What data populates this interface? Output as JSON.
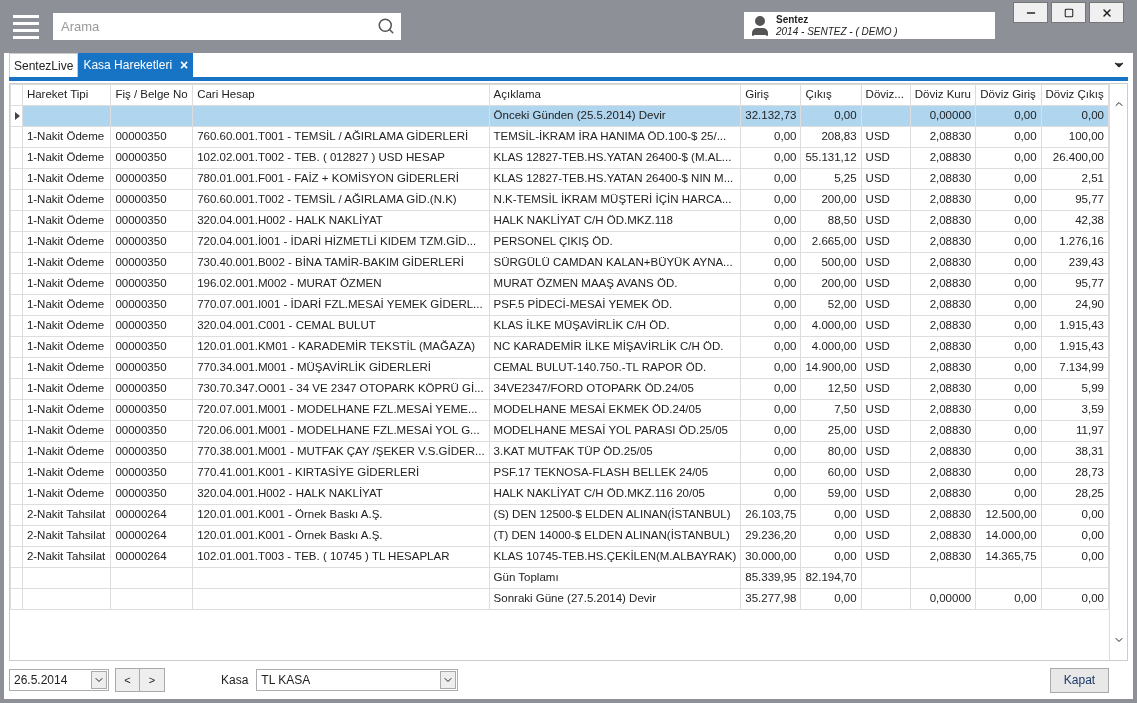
{
  "search": {
    "placeholder": "Arama"
  },
  "user": {
    "name": "Sentez",
    "company": "2014 - SENTEZ - ( DEMO )"
  },
  "tabs": [
    {
      "label": "SentezLive",
      "selected": false,
      "closable": false
    },
    {
      "label": "Kasa Hareketleri",
      "selected": true,
      "closable": true
    }
  ],
  "close_glyph": "×",
  "table": {
    "columns": [
      {
        "label": "Hareket Tipi",
        "kind": "text"
      },
      {
        "label": "Fiş / Belge No",
        "kind": "text"
      },
      {
        "label": "Cari Hesap",
        "kind": "text"
      },
      {
        "label": "Açıklama",
        "kind": "text"
      },
      {
        "label": "Giriş",
        "kind": "amount"
      },
      {
        "label": "Çıkış",
        "kind": "amount"
      },
      {
        "label": "Döviz...",
        "kind": "text"
      },
      {
        "label": "Döviz Kuru",
        "kind": "amount"
      },
      {
        "label": "Döviz Giriş",
        "kind": "amount"
      },
      {
        "label": "Döviz Çıkış",
        "kind": "amount"
      }
    ],
    "rows": [
      {
        "selected": true,
        "cells": [
          null,
          null,
          null,
          "Önceki Günden (25.5.2014) Devir",
          "32.132,73",
          "0,00",
          null,
          "0,00000",
          "0,00",
          "0,00"
        ]
      },
      {
        "selected": false,
        "cells": [
          "1-Nakit Ödeme",
          "00000350",
          "760.60.001.T001 - TEMSİL / AĞIRLAMA GİDERLERİ",
          "TEMSİL-İKRAM İRA HANIMA ÖD.100-$ 25/...",
          "0,00",
          "208,83",
          "USD",
          "2,08830",
          "0,00",
          "100,00"
        ]
      },
      {
        "selected": false,
        "cells": [
          "1-Nakit Ödeme",
          "00000350",
          "102.02.001.T002 - TEB. ( 012827 ) USD HESAP",
          "KLAS 12827-TEB.HS.YATAN 26400-$ (M.AL...",
          "0,00",
          "55.131,12",
          "USD",
          "2,08830",
          "0,00",
          "26.400,00"
        ]
      },
      {
        "selected": false,
        "cells": [
          "1-Nakit Ödeme",
          "00000350",
          "780.01.001.F001 - FAİZ + KOMİSYON GİDERLERİ",
          "KLAS 12827-TEB.HS.YATAN 26400-$ NIN M...",
          "0,00",
          "5,25",
          "USD",
          "2,08830",
          "0,00",
          "2,51"
        ]
      },
      {
        "selected": false,
        "cells": [
          "1-Nakit Ödeme",
          "00000350",
          "760.60.001.T002 - TEMSİL / AĞIRLAMA GİD.(N.K)",
          "N.K-TEMSİL İKRAM MÜŞTERİ İÇİN HARCA...",
          "0,00",
          "200,00",
          "USD",
          "2,08830",
          "0,00",
          "95,77"
        ]
      },
      {
        "selected": false,
        "cells": [
          "1-Nakit Ödeme",
          "00000350",
          "320.04.001.H002 - HALK NAKLİYAT",
          "HALK NAKLİYAT C/H ÖD.MKZ.118",
          "0,00",
          "88,50",
          "USD",
          "2,08830",
          "0,00",
          "42,38"
        ]
      },
      {
        "selected": false,
        "cells": [
          "1-Nakit Ödeme",
          "00000350",
          "720.04.001.İ001 - İDARİ HİZMETLİ KIDEM TZM.GİD...",
          "PERSONEL ÇIKIŞ ÖD.",
          "0,00",
          "2.665,00",
          "USD",
          "2,08830",
          "0,00",
          "1.276,16"
        ]
      },
      {
        "selected": false,
        "cells": [
          "1-Nakit Ödeme",
          "00000350",
          "730.40.001.B002 - BİNA TAMİR-BAKIM GİDERLERİ",
          "SÜRGÜLÜ CAMDAN KALAN+BÜYÜK AYNA...",
          "0,00",
          "500,00",
          "USD",
          "2,08830",
          "0,00",
          "239,43"
        ]
      },
      {
        "selected": false,
        "cells": [
          "1-Nakit Ödeme",
          "00000350",
          "196.02.001.M002 - MURAT ÖZMEN",
          "MURAT ÖZMEN MAAŞ AVANS ÖD.",
          "0,00",
          "200,00",
          "USD",
          "2,08830",
          "0,00",
          "95,77"
        ]
      },
      {
        "selected": false,
        "cells": [
          "1-Nakit Ödeme",
          "00000350",
          "770.07.001.I001 - İDARİ FZL.MESAİ YEMEK GİDERL...",
          "PSF.5 PİDECİ-MESAİ YEMEK ÖD.",
          "0,00",
          "52,00",
          "USD",
          "2,08830",
          "0,00",
          "24,90"
        ]
      },
      {
        "selected": false,
        "cells": [
          "1-Nakit Ödeme",
          "00000350",
          "320.04.001.C001 - CEMAL BULUT",
          "KLAS İLKE MÜŞAVİRLİK C/H ÖD.",
          "0,00",
          "4.000,00",
          "USD",
          "2,08830",
          "0,00",
          "1.915,43"
        ]
      },
      {
        "selected": false,
        "cells": [
          "1-Nakit Ödeme",
          "00000350",
          "120.01.001.KM01 - KARADEMİR TEKSTİL (MAĞAZA)",
          "NC KARADEMİR İLKE MİŞAVİRLİK C/H ÖD.",
          "0,00",
          "4.000,00",
          "USD",
          "2,08830",
          "0,00",
          "1.915,43"
        ]
      },
      {
        "selected": false,
        "cells": [
          "1-Nakit Ödeme",
          "00000350",
          "770.34.001.M001 - MÜŞAVİRLİK GİDERLERİ",
          "CEMAL BULUT-140.750.-TL RAPOR ÖD.",
          "0,00",
          "14.900,00",
          "USD",
          "2,08830",
          "0,00",
          "7.134,99"
        ]
      },
      {
        "selected": false,
        "cells": [
          "1-Nakit Ödeme",
          "00000350",
          "730.70.347.O001 - 34 VE 2347 OTOPARK KÖPRÜ Gİ...",
          "34VE2347/FORD OTOPARK ÖD.24/05",
          "0,00",
          "12,50",
          "USD",
          "2,08830",
          "0,00",
          "5,99"
        ]
      },
      {
        "selected": false,
        "cells": [
          "1-Nakit Ödeme",
          "00000350",
          "720.07.001.M001 - MODELHANE FZL.MESAİ YEME...",
          "MODELHANE MESAİ EKMEK ÖD.24/05",
          "0,00",
          "7,50",
          "USD",
          "2,08830",
          "0,00",
          "3,59"
        ]
      },
      {
        "selected": false,
        "cells": [
          "1-Nakit Ödeme",
          "00000350",
          "720.06.001.M001 - MODELHANE FZL.MESAİ YOL G...",
          "MODELHANE MESAİ YOL PARASI ÖD.25/05",
          "0,00",
          "25,00",
          "USD",
          "2,08830",
          "0,00",
          "11,97"
        ]
      },
      {
        "selected": false,
        "cells": [
          "1-Nakit Ödeme",
          "00000350",
          "770.38.001.M001 - MUTFAK ÇAY /ŞEKER V.S.GİDER...",
          "3.KAT MUTFAK TÜP ÖD.25/05",
          "0,00",
          "80,00",
          "USD",
          "2,08830",
          "0,00",
          "38,31"
        ]
      },
      {
        "selected": false,
        "cells": [
          "1-Nakit Ödeme",
          "00000350",
          "770.41.001.K001 - KIRTASİYE GİDERLERİ",
          "PSF.17 TEKNOSA-FLASH BELLEK 24/05",
          "0,00",
          "60,00",
          "USD",
          "2,08830",
          "0,00",
          "28,73"
        ]
      },
      {
        "selected": false,
        "cells": [
          "1-Nakit Ödeme",
          "00000350",
          "320.04.001.H002 - HALK NAKLİYAT",
          "HALK NAKLİYAT C/H ÖD.MKZ.116 20/05",
          "0,00",
          "59,00",
          "USD",
          "2,08830",
          "0,00",
          "28,25"
        ]
      },
      {
        "selected": false,
        "cells": [
          "2-Nakit Tahsilat",
          "00000264",
          "120.01.001.K001 - Örnek Baskı A.Ş.",
          "(S) DEN 12500-$ ELDEN ALINAN(İSTANBUL)",
          "26.103,75",
          "0,00",
          "USD",
          "2,08830",
          "12.500,00",
          "0,00"
        ]
      },
      {
        "selected": false,
        "cells": [
          "2-Nakit Tahsilat",
          "00000264",
          "120.01.001.K001 - Örnek Baskı A.Ş.",
          "(T) DEN 14000-$ ELDEN ALINAN(İSTANBUL)",
          "29.236,20",
          "0,00",
          "USD",
          "2,08830",
          "14.000,00",
          "0,00"
        ]
      },
      {
        "selected": false,
        "cells": [
          "2-Nakit Tahsilat",
          "00000264",
          "102.01.001.T003 - TEB. ( 10745 ) TL HESAPLAR",
          "KLAS 10745-TEB.HS.ÇEKİLEN(M.ALBAYRAK)",
          "30.000,00",
          "0,00",
          "USD",
          "2,08830",
          "14.365,75",
          "0,00"
        ]
      },
      {
        "selected": false,
        "cells": [
          null,
          null,
          null,
          "Gün Toplamı",
          "85.339,95",
          "82.194,70",
          null,
          null,
          null,
          null
        ]
      },
      {
        "selected": false,
        "cells": [
          null,
          null,
          null,
          "Sonraki Güne (27.5.2014) Devir",
          "35.277,98",
          "0,00",
          null,
          "0,00000",
          "0,00",
          "0,00"
        ]
      }
    ]
  },
  "footer": {
    "date": "26.5.2014",
    "prev": "<",
    "next": ">",
    "kasa_label": "Kasa",
    "kasa": "TL KASA",
    "close_button": "Kapat"
  }
}
